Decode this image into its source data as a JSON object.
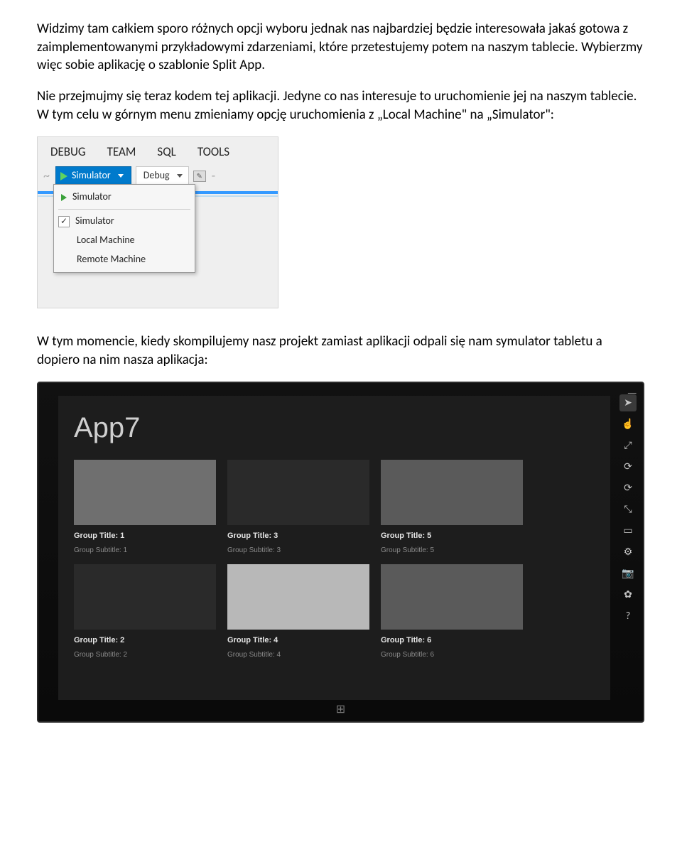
{
  "paragraphs": {
    "p1": "Widzimy tam całkiem sporo różnych opcji wyboru jednak nas najbardziej będzie interesowała jakaś gotowa z zaimplementowanymi przykładowymi zdarzeniami, które przetestujemy potem na naszym tablecie. Wybierzmy więc sobie aplikację o szablonie Split App.",
    "p2": "Nie przejmujmy się teraz kodem tej aplikacji. Jedyne co nas interesuje to uruchomienie jej na naszym tablecie. W tym celu w górnym menu zmieniamy opcję uruchomienia z „Local Machine\" na „Simulator\":",
    "p3": "W tym momencie, kiedy skompilujemy nasz projekt zamiast aplikacji odpali się nam symulator tabletu a dopiero na nim nasza aplikacja:"
  },
  "menubar": [
    "DEBUG",
    "TEAM",
    "SQL",
    "TOOLS"
  ],
  "toolbar": {
    "run_label": "Simulator",
    "config_label": "Debug"
  },
  "dropdown": {
    "header": "Simulator",
    "items": [
      "Simulator",
      "Local Machine",
      "Remote Machine"
    ],
    "checked": "Simulator"
  },
  "simulator": {
    "app_title": "App7",
    "tiles": [
      {
        "title": "Group Title: 1",
        "sub": "Group Subtitle: 1"
      },
      {
        "title": "Group Title: 3",
        "sub": "Group Subtitle: 3"
      },
      {
        "title": "Group Title: 5",
        "sub": "Group Subtitle: 5"
      },
      {
        "title": "Group Title: 2",
        "sub": "Group Subtitle: 2"
      },
      {
        "title": "Group Title: 4",
        "sub": "Group Subtitle: 4"
      },
      {
        "title": "Group Title: 6",
        "sub": "Group Subtitle: 6"
      }
    ],
    "sidebar_icons": [
      "−",
      "➤",
      "☝",
      "⤢",
      "⟳",
      "⟳",
      "⤡",
      "▭",
      "⚙",
      "📷",
      "✿",
      "?"
    ]
  }
}
